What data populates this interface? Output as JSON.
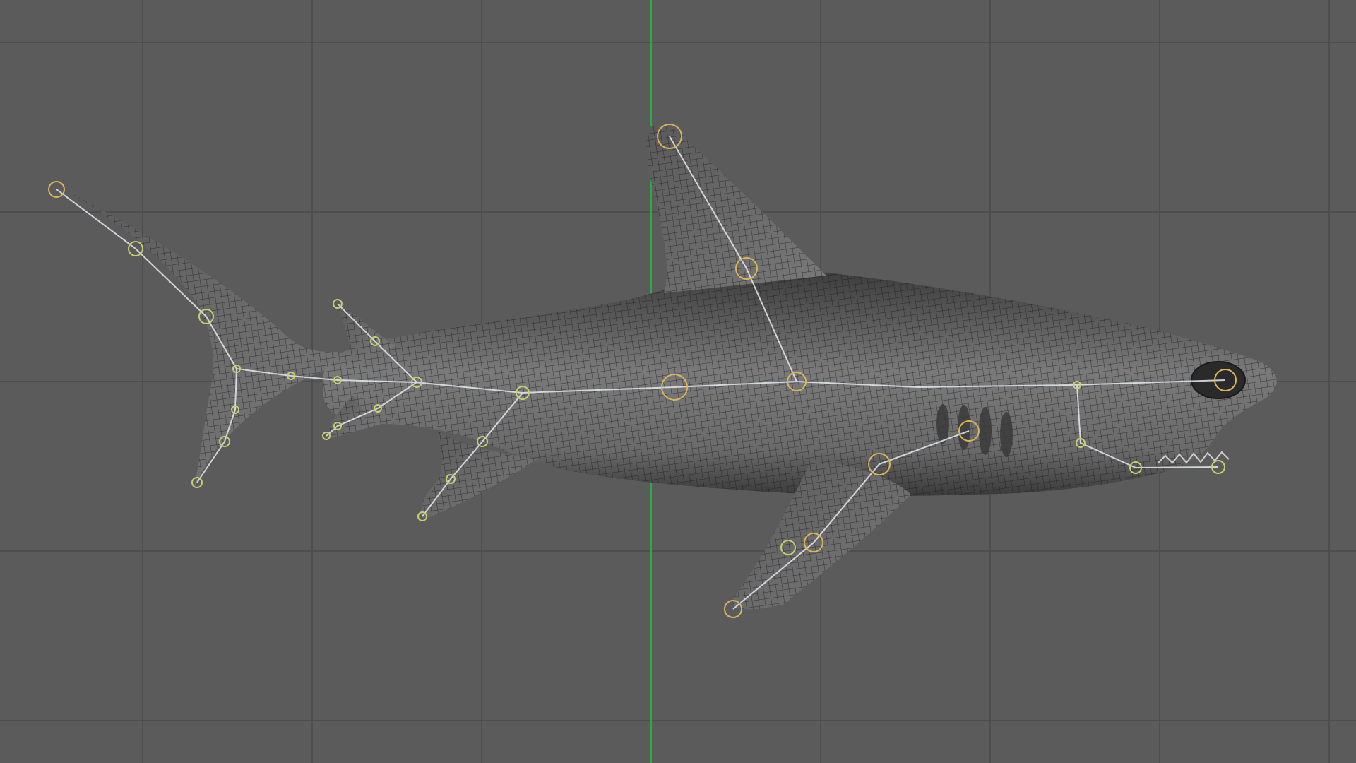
{
  "viewport": {
    "view": "side",
    "background_color": "#5b5b5b",
    "grid_color": "#4b4b4b",
    "axis_color": "#2fa84a",
    "grid_visible": true
  },
  "model": {
    "mesh_fill_color": "#6e6e6e",
    "mesh_dark_color": "#2a2a2a",
    "wireframe_color": "#1d1d1d",
    "wireframe_visible": true
  },
  "rig": {
    "bone_color": "#e6eaf0",
    "joint_color": "#c8cf70",
    "joint_outer_color": "#d9b65a",
    "bones_visible": true
  }
}
